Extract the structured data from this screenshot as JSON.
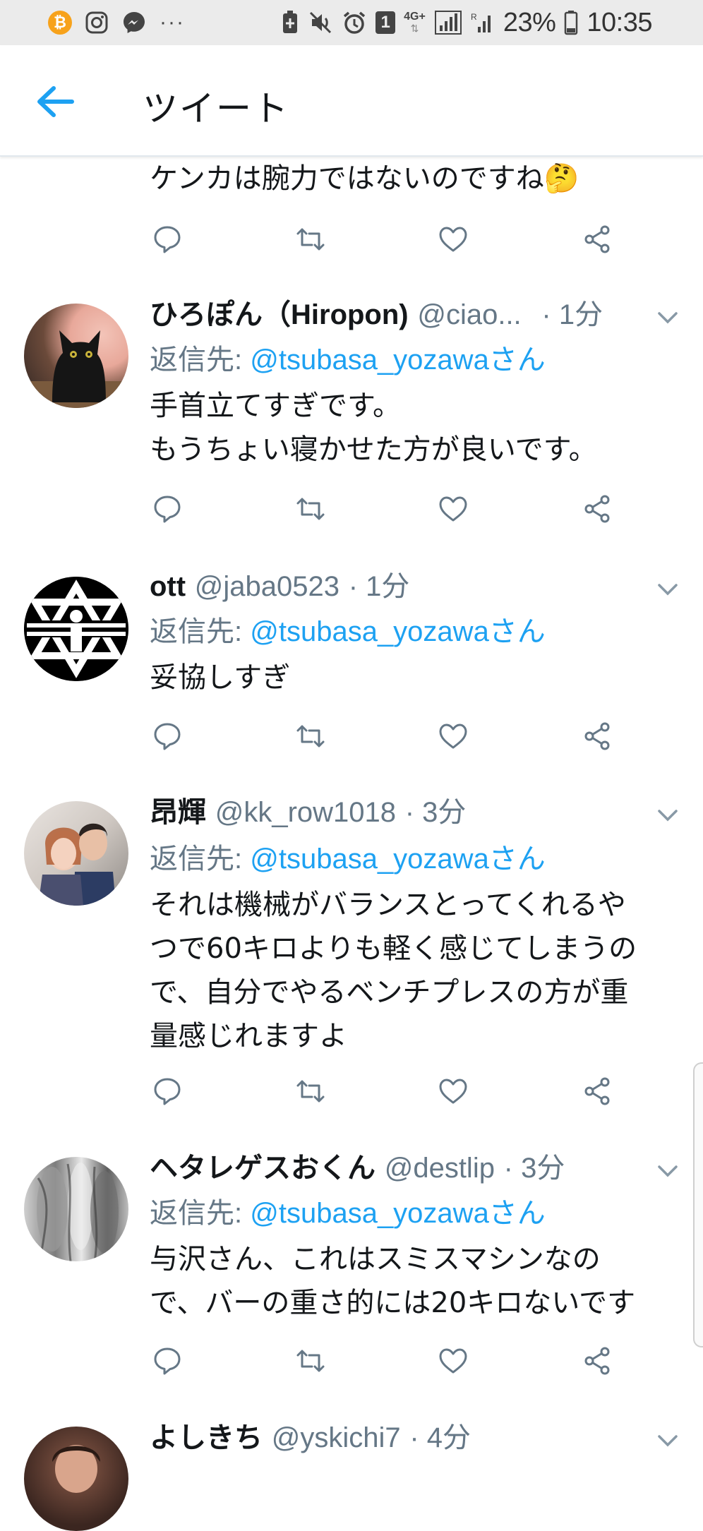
{
  "status_bar": {
    "btc_symbol": "₿",
    "icons_left": [
      "bitcoin-icon",
      "instagram-icon",
      "messenger-icon"
    ],
    "more": "···",
    "badge": "1",
    "network": "4G+",
    "battery": "23%",
    "time": "10:35"
  },
  "header": {
    "title": "ツイート"
  },
  "partial_tweet": {
    "text": "ケンカは腕力ではないのですね🤔"
  },
  "tweets": [
    {
      "name": "ひろぽん（Hiropon)",
      "handle": "@ciao...",
      "time": "· 1分",
      "reply_prefix": "返信先: ",
      "reply_handle": "@tsubasa_yozawaさん",
      "text": "手首立てすぎです。\nもうちょい寝かせた方が良いです。",
      "avatar": "black-cat-avatar"
    },
    {
      "name": "ott",
      "handle": "@jaba0523",
      "time": "· 1分",
      "reply_prefix": "返信先: ",
      "reply_handle": "@tsubasa_yozawaさん",
      "text": "妥協しすぎ",
      "avatar": "emblem-avatar"
    },
    {
      "name": "昂輝",
      "handle": "@kk_row1018",
      "time": "· 3分",
      "reply_prefix": "返信先: ",
      "reply_handle": "@tsubasa_yozawaさん",
      "text": "それは機械がバランスとってくれるや\nつで60キロよりも軽く感じてしまうの\nで、自分でやるベンチプレスの方が重\n量感じれますよ",
      "avatar": "couple-photo-avatar"
    },
    {
      "name": "ヘタレゲスおくん",
      "handle": "@destlip",
      "time": "· 3分",
      "reply_prefix": "返信先: ",
      "reply_handle": "@tsubasa_yozawaさん",
      "text": "与沢さん、これはスミスマシンなの\nで、バーの重さ的には20キロないです",
      "avatar": "muscle-photo-avatar"
    },
    {
      "name": "よしきち",
      "handle": "@yskichi7",
      "time": "· 4分",
      "avatar": "photo-avatar"
    }
  ],
  "colors": {
    "accent": "#1da1f2",
    "meta": "#657786",
    "text": "#14171a",
    "divider": "#e6ecf0"
  }
}
